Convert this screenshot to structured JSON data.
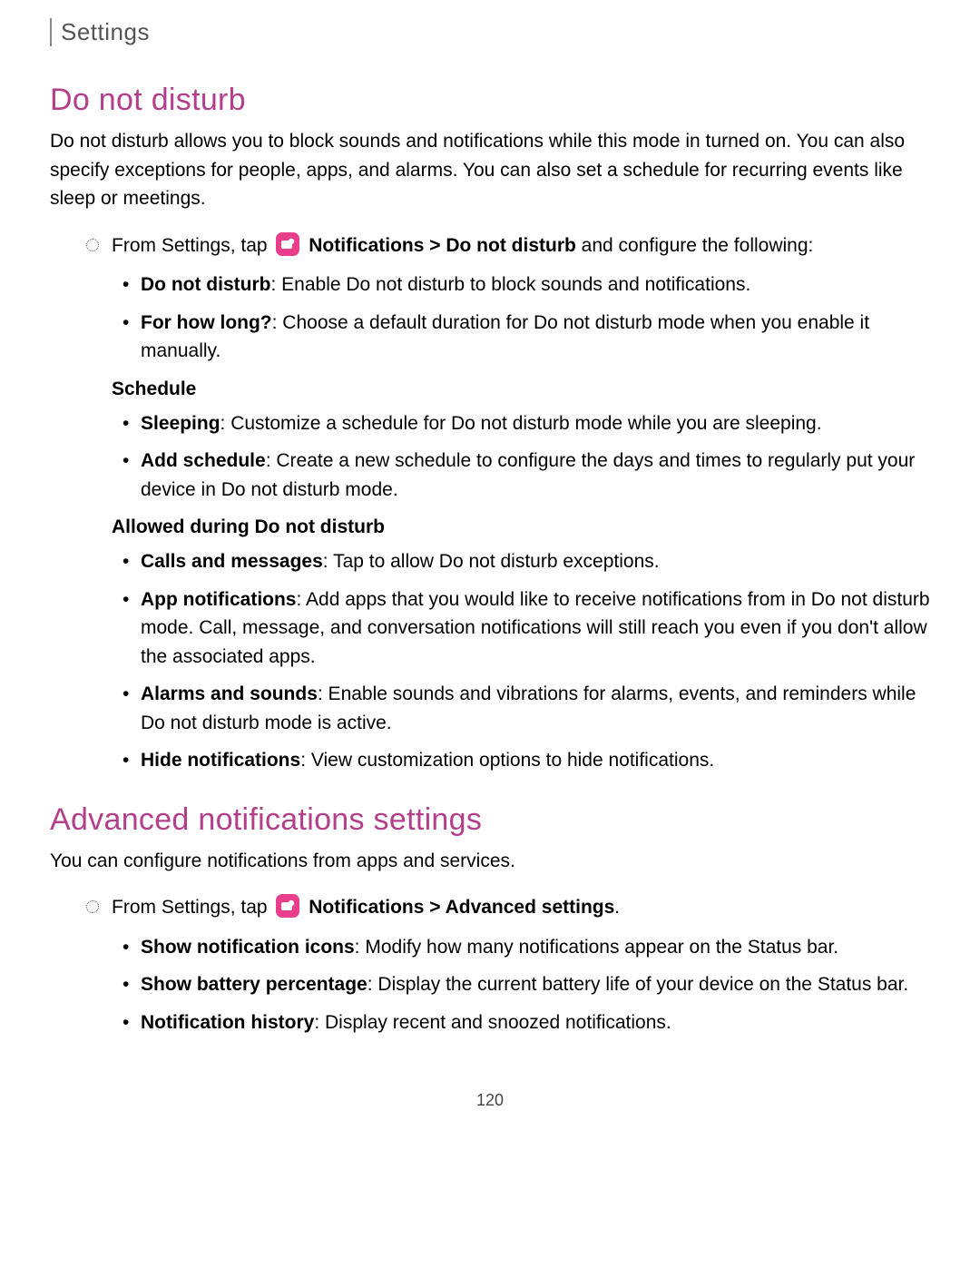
{
  "header": {
    "title": "Settings"
  },
  "section1": {
    "heading": "Do not disturb",
    "intro": "Do not disturb allows you to block sounds and notifications while this mode in turned on. You can also specify exceptions for people, apps, and alarms. You can also set a schedule for recurring events like sleep or meetings.",
    "step_prefix": "From Settings, tap ",
    "step_link1": "Notifications",
    "step_sep": " > ",
    "step_link2": "Do not disturb",
    "step_suffix": " and configure the following:",
    "items_a": [
      {
        "term": "Do not disturb",
        "desc": ": Enable Do not disturb to block sounds and notifications."
      },
      {
        "term": "For how long?",
        "desc": ": Choose a default duration for Do not disturb mode when you enable it manually."
      }
    ],
    "group_schedule": {
      "heading": "Schedule",
      "items": [
        {
          "term": "Sleeping",
          "desc": ": Customize a schedule for Do not disturb mode while you are sleeping."
        },
        {
          "term": "Add schedule",
          "desc": ": Create a new schedule to configure the days and times to regularly put your device in Do not disturb mode."
        }
      ]
    },
    "group_allowed": {
      "heading": "Allowed during Do not disturb",
      "items": [
        {
          "term": "Calls and messages",
          "desc": ": Tap to allow Do not disturb exceptions."
        },
        {
          "term": "App notifications",
          "desc": ": Add apps that you would like to receive notifications from in Do not disturb mode. Call, message, and conversation notifications will still reach you even if you don't allow the associated apps."
        },
        {
          "term": "Alarms and sounds",
          "desc": ": Enable sounds and vibrations for alarms, events, and reminders while Do not disturb mode is active."
        },
        {
          "term": "Hide notifications",
          "desc": ": View customization options to hide notifications."
        }
      ]
    }
  },
  "section2": {
    "heading": "Advanced notifications settings",
    "intro": "You can configure notifications from apps and services.",
    "step_prefix": "From Settings, tap ",
    "step_link1": "Notifications",
    "step_sep": " > ",
    "step_link2": "Advanced settings",
    "step_suffix": ".",
    "items": [
      {
        "term": "Show notification icons",
        "desc": ": Modify how many notifications appear on the Status bar."
      },
      {
        "term": "Show battery percentage",
        "desc": ": Display the current battery life of your device on the Status bar."
      },
      {
        "term": "Notification history",
        "desc": ": Display recent and snoozed notifications."
      }
    ]
  },
  "page_number": "120"
}
